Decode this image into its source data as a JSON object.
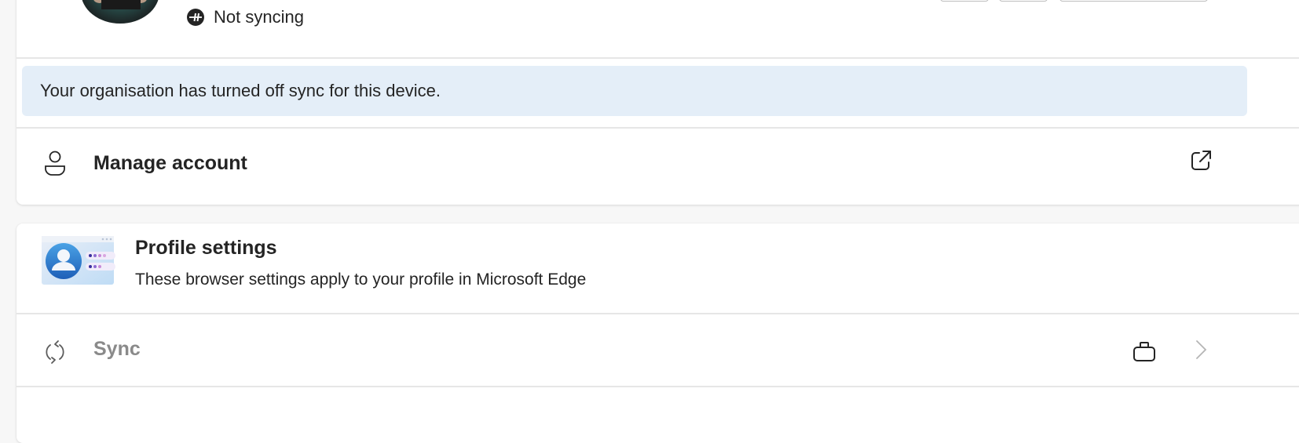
{
  "account": {
    "avatar_alt": "Profile picture",
    "sync_status_icon": "not-syncing-icon",
    "sync_status": "Not syncing",
    "header_buttons": [
      "",
      "",
      ""
    ],
    "policy_banner": "Your organisation has turned off sync for this device.",
    "manage_account": {
      "label": "Manage account",
      "icon": "person-icon",
      "trailing_icon": "open-external-icon"
    }
  },
  "profile_settings": {
    "illustration": "profile-illustration",
    "title": "Profile settings",
    "description": "These browser settings apply to your profile in Microsoft Edge",
    "items": [
      {
        "label": "Sync",
        "icon": "sync-icon",
        "disabled": true,
        "badge_icon": "briefcase-icon",
        "trailing_icon": "chevron-right-icon"
      }
    ]
  },
  "colors": {
    "banner_bg": "#e4eef8",
    "page_bg": "#f7f7f7",
    "disabled_text": "#8a8a8a"
  }
}
